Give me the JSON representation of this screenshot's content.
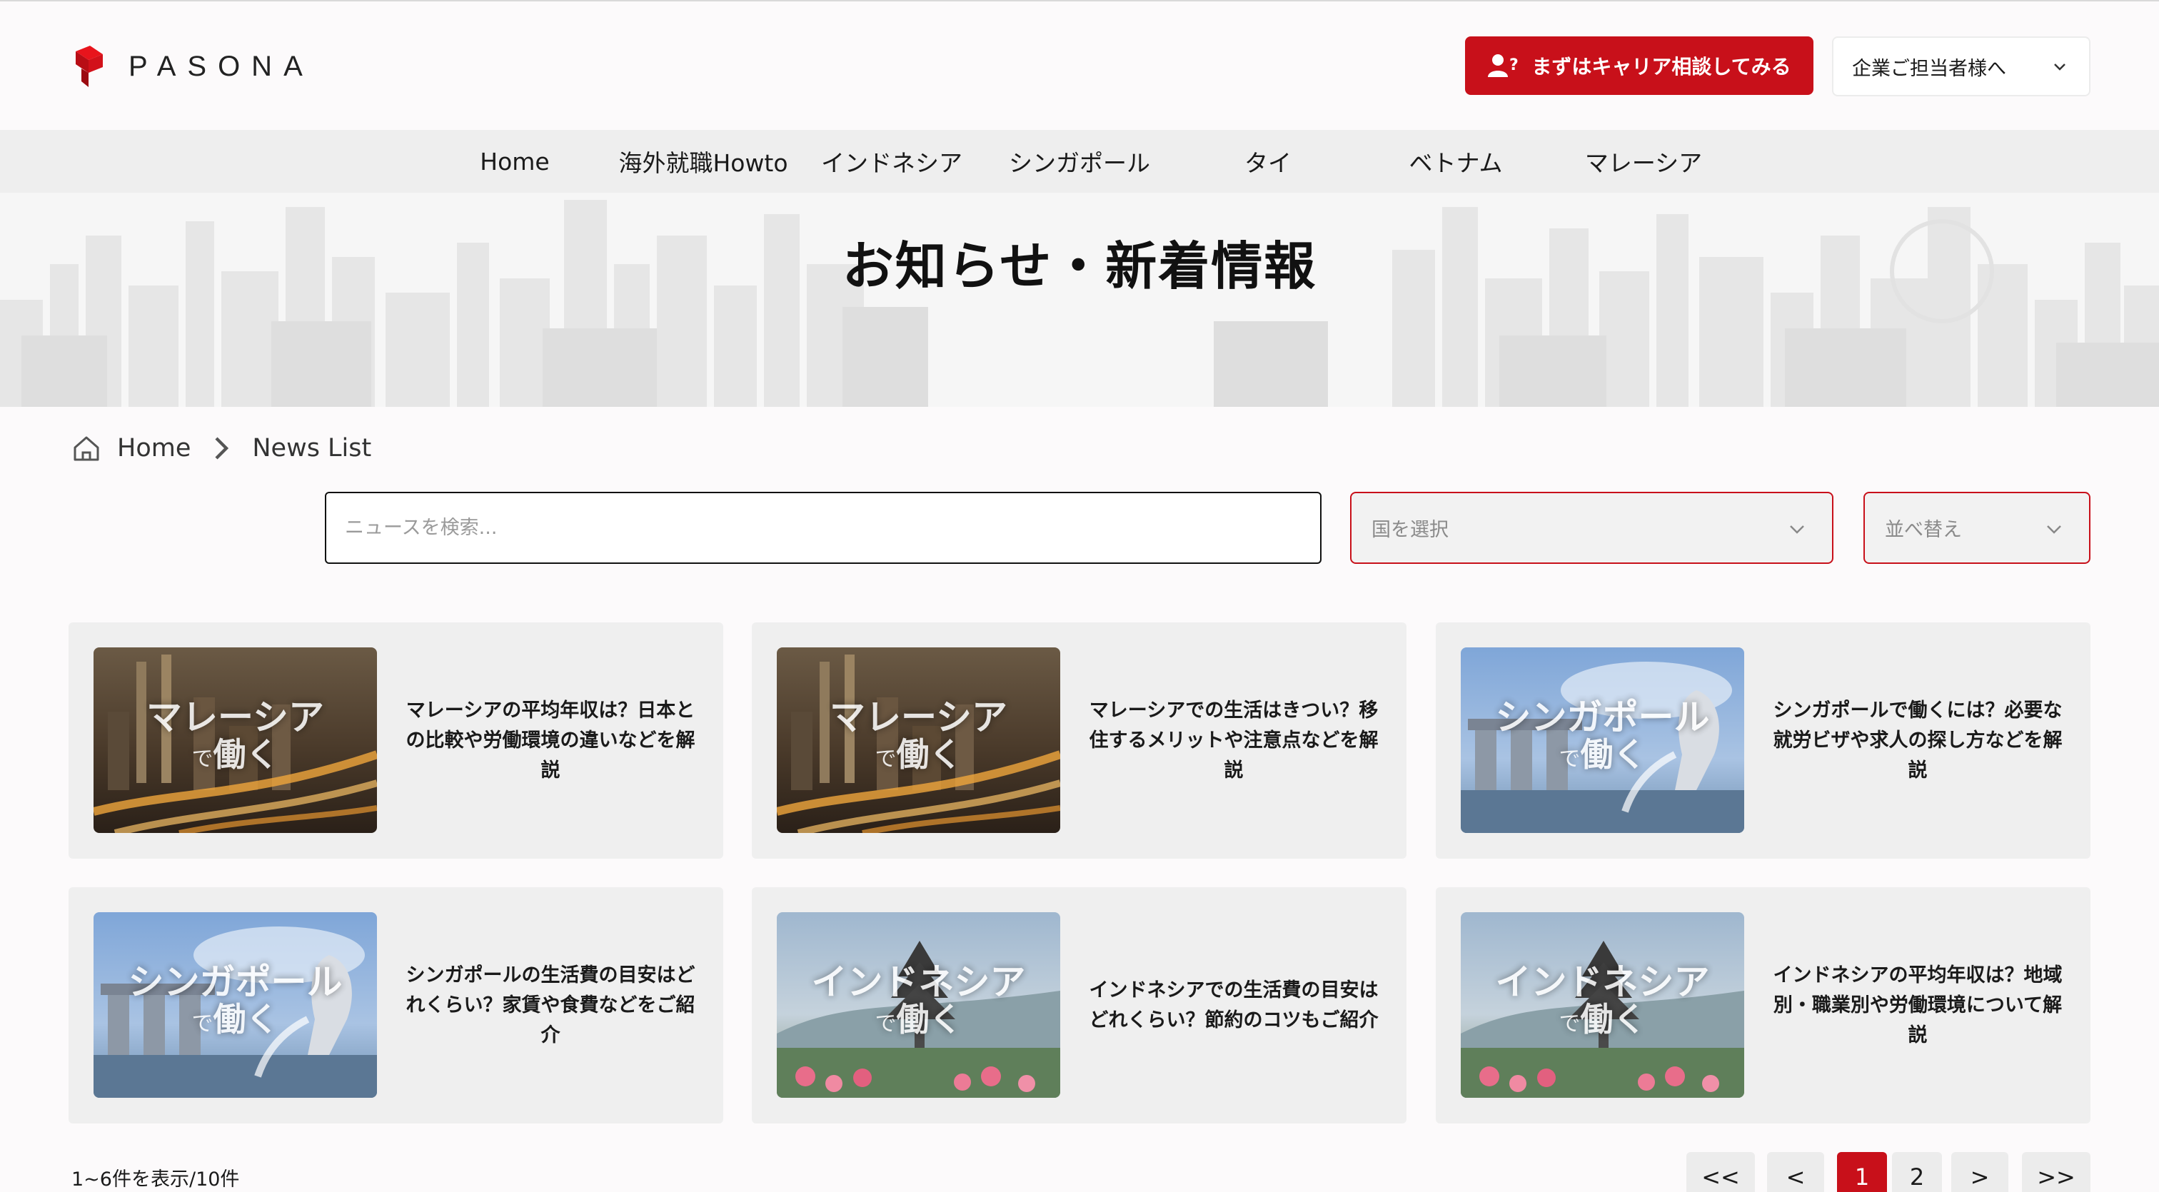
{
  "brand": {
    "name": "PASONA",
    "accent": "#c8101a"
  },
  "header": {
    "cta_label": "まずはキャリア相談してみる",
    "cta_icon": "user-question-icon",
    "corp_select_label": "企業ご担当者様へ"
  },
  "nav": {
    "items": [
      {
        "label": "Home"
      },
      {
        "label": "海外就職Howto"
      },
      {
        "label": "インドネシア"
      },
      {
        "label": "シンガポール"
      },
      {
        "label": "タイ"
      },
      {
        "label": "ベトナム"
      },
      {
        "label": "マレーシア"
      }
    ]
  },
  "hero": {
    "title": "お知らせ・新着情報"
  },
  "breadcrumb": {
    "home": "Home",
    "current": "News List"
  },
  "filters": {
    "search_placeholder": "ニュースを検索...",
    "country_placeholder": "国を選択",
    "sort_placeholder": "並べ替え"
  },
  "articles": [
    {
      "thumb_big": "マレーシア",
      "thumb_small": "で",
      "thumb_small_big": "働く",
      "thumb_theme": "malaysia",
      "title": "マレーシアの平均年収は？日本との比較や労働環境の違いなどを解説"
    },
    {
      "thumb_big": "マレーシア",
      "thumb_small": "で",
      "thumb_small_big": "働く",
      "thumb_theme": "malaysia",
      "title": "マレーシアでの生活はきつい？移住するメリットや注意点などを解説"
    },
    {
      "thumb_big": "シンガポール",
      "thumb_small": "で",
      "thumb_small_big": "働く",
      "thumb_theme": "singapore",
      "title": "シンガポールで働くには？必要な就労ビザや求人の探し方などを解説"
    },
    {
      "thumb_big": "シンガポール",
      "thumb_small": "で",
      "thumb_small_big": "働く",
      "thumb_theme": "singapore",
      "title": "シンガポールの生活費の目安はどれくらい？家賃や食費などをご紹介"
    },
    {
      "thumb_big": "インドネシア",
      "thumb_small": "で",
      "thumb_small_big": "働く",
      "thumb_theme": "indonesia",
      "title": "インドネシアでの生活費の目安はどれくらい？節約のコツもご紹介"
    },
    {
      "thumb_big": "インドネシア",
      "thumb_small": "で",
      "thumb_small_big": "働く",
      "thumb_theme": "indonesia",
      "title": "インドネシアの平均年収は？地域別・職業別や労働環境について解説"
    }
  ],
  "pagination": {
    "count_text": "1~6件を表示/10件",
    "first": "<<",
    "prev": "<",
    "pages": [
      "1",
      "2"
    ],
    "current_page": "1",
    "next": ">",
    "last": ">>"
  }
}
